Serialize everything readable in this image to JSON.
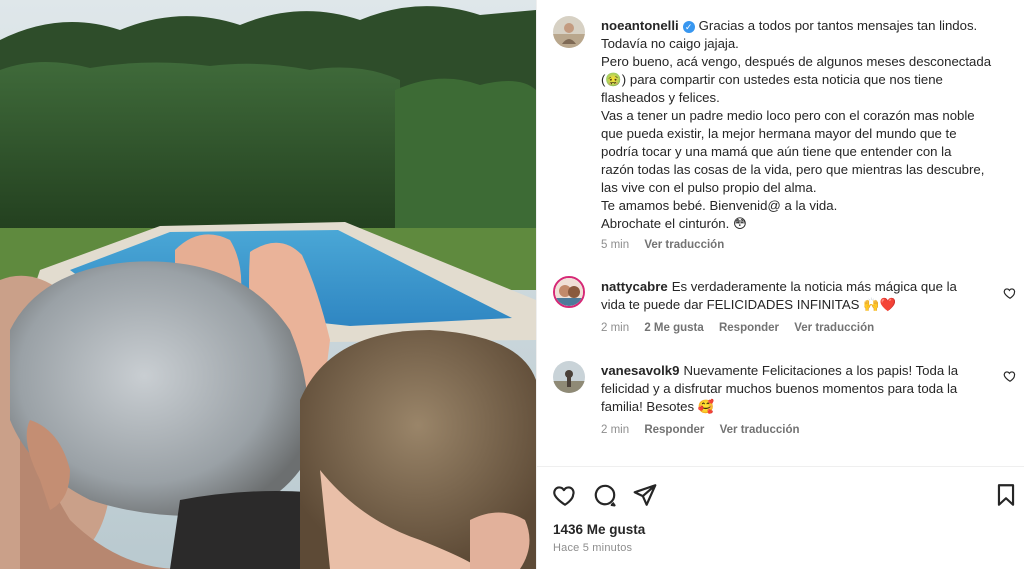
{
  "post": {
    "author": "noeantonelli",
    "caption_lines": [
      "Gracias a todos por tantos mensajes tan lindos.",
      "Todavía no caigo jajaja.",
      "Pero bueno, acá vengo, después de algunos meses desconectada",
      "(🤢) para compartir con ustedes esta noticia que nos tiene",
      "flasheados y felices.",
      "Vas a tener un padre medio loco pero con el corazón mas noble",
      "que pueda existir, la mejor hermana mayor del mundo que te",
      "podría tocar y una mamá que aún tiene que entender con la",
      "razón todas las cosas de la vida, pero que mientras las descubre,",
      "las vive con el pulso propio del alma.",
      "Te amamos bebé. Bienvenid@ a la vida.",
      "Abrochate el cinturón. 😳"
    ],
    "time": "5 min",
    "see_translation": "Ver traducción"
  },
  "comments": [
    {
      "user": "nattycabre",
      "lines": [
        "Es verdaderamente la noticia más mágica que la",
        "vida te puede dar FELICIDADES INFINITAS 🙌❤️"
      ],
      "time": "2 min",
      "likes": "2 Me gusta",
      "reply": "Responder",
      "see_translation": "Ver traducción"
    },
    {
      "user": "vanesavolk9",
      "lines": [
        "Nuevamente Felicitaciones a los papis! Toda la",
        "felicidad y a disfrutar muchos buenos momentos para toda la",
        "familia! Besotes 🥰"
      ],
      "time": "2 min",
      "reply": "Responder",
      "see_translation": "Ver traducción"
    }
  ],
  "footer": {
    "likes": "1436 Me gusta",
    "time_ago": "Hace 5 minutos"
  },
  "icons": {
    "like": "heart-icon",
    "comment": "comment-icon",
    "share": "share-icon",
    "save": "bookmark-icon"
  },
  "colors": {
    "verified": "#3897f0",
    "heart": "#ed4956",
    "muted": "#8e8e8e",
    "text": "#262626"
  }
}
